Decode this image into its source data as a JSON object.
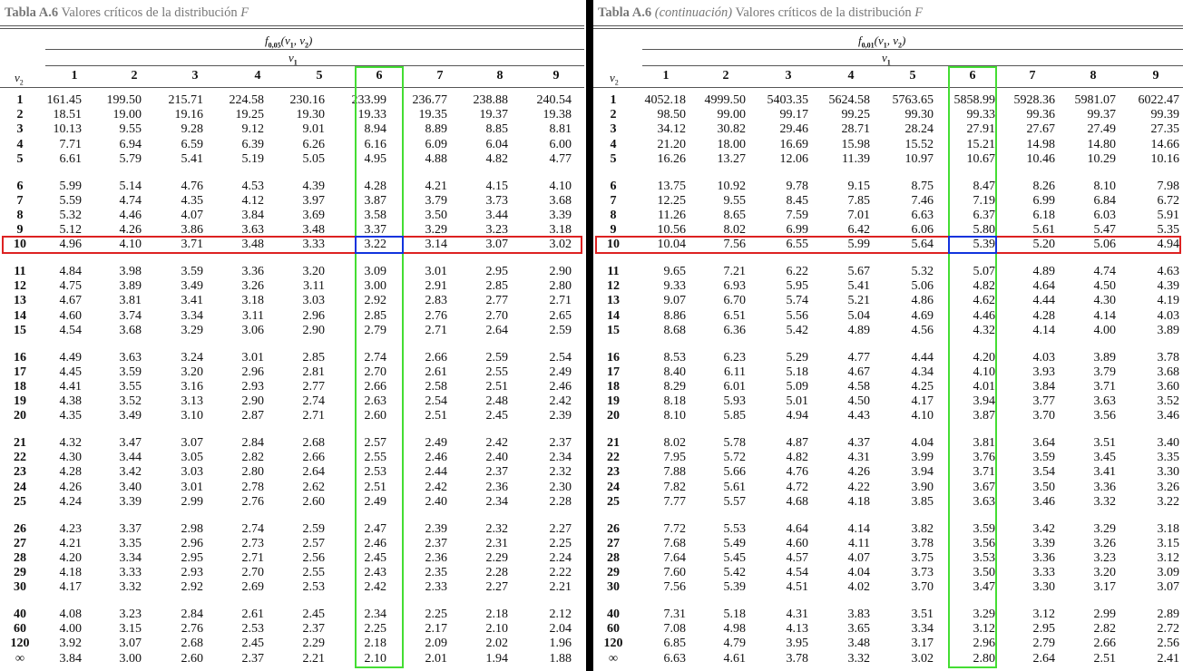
{
  "left": {
    "caption_prefix": "Tabla A.6",
    "caption_cont": "",
    "caption_text": "Valores críticos de la distribución",
    "caption_var": "F",
    "func_f": "f",
    "func_sub": "0,05",
    "func_args": "(v",
    "func_rest1": ", v",
    "func_rest2": ")",
    "v1_label": "v",
    "v2_label": "v",
    "columns": [
      "1",
      "2",
      "3",
      "4",
      "5",
      "6",
      "7",
      "8",
      "9"
    ],
    "rows": [
      {
        "v2": "1",
        "vals": [
          "161.45",
          "199.50",
          "215.71",
          "224.58",
          "230.16",
          "233.99",
          "236.77",
          "238.88",
          "240.54"
        ]
      },
      {
        "v2": "2",
        "vals": [
          "18.51",
          "19.00",
          "19.16",
          "19.25",
          "19.30",
          "19.33",
          "19.35",
          "19.37",
          "19.38"
        ]
      },
      {
        "v2": "3",
        "vals": [
          "10.13",
          "9.55",
          "9.28",
          "9.12",
          "9.01",
          "8.94",
          "8.89",
          "8.85",
          "8.81"
        ]
      },
      {
        "v2": "4",
        "vals": [
          "7.71",
          "6.94",
          "6.59",
          "6.39",
          "6.26",
          "6.16",
          "6.09",
          "6.04",
          "6.00"
        ]
      },
      {
        "v2": "5",
        "vals": [
          "6.61",
          "5.79",
          "5.41",
          "5.19",
          "5.05",
          "4.95",
          "4.88",
          "4.82",
          "4.77"
        ]
      },
      {
        "v2": "6",
        "vals": [
          "5.99",
          "5.14",
          "4.76",
          "4.53",
          "4.39",
          "4.28",
          "4.21",
          "4.15",
          "4.10"
        ]
      },
      {
        "v2": "7",
        "vals": [
          "5.59",
          "4.74",
          "4.35",
          "4.12",
          "3.97",
          "3.87",
          "3.79",
          "3.73",
          "3.68"
        ]
      },
      {
        "v2": "8",
        "vals": [
          "5.32",
          "4.46",
          "4.07",
          "3.84",
          "3.69",
          "3.58",
          "3.50",
          "3.44",
          "3.39"
        ]
      },
      {
        "v2": "9",
        "vals": [
          "5.12",
          "4.26",
          "3.86",
          "3.63",
          "3.48",
          "3.37",
          "3.29",
          "3.23",
          "3.18"
        ]
      },
      {
        "v2": "10",
        "vals": [
          "4.96",
          "4.10",
          "3.71",
          "3.48",
          "3.33",
          "3.22",
          "3.14",
          "3.07",
          "3.02"
        ]
      },
      {
        "v2": "11",
        "vals": [
          "4.84",
          "3.98",
          "3.59",
          "3.36",
          "3.20",
          "3.09",
          "3.01",
          "2.95",
          "2.90"
        ]
      },
      {
        "v2": "12",
        "vals": [
          "4.75",
          "3.89",
          "3.49",
          "3.26",
          "3.11",
          "3.00",
          "2.91",
          "2.85",
          "2.80"
        ]
      },
      {
        "v2": "13",
        "vals": [
          "4.67",
          "3.81",
          "3.41",
          "3.18",
          "3.03",
          "2.92",
          "2.83",
          "2.77",
          "2.71"
        ]
      },
      {
        "v2": "14",
        "vals": [
          "4.60",
          "3.74",
          "3.34",
          "3.11",
          "2.96",
          "2.85",
          "2.76",
          "2.70",
          "2.65"
        ]
      },
      {
        "v2": "15",
        "vals": [
          "4.54",
          "3.68",
          "3.29",
          "3.06",
          "2.90",
          "2.79",
          "2.71",
          "2.64",
          "2.59"
        ]
      },
      {
        "v2": "16",
        "vals": [
          "4.49",
          "3.63",
          "3.24",
          "3.01",
          "2.85",
          "2.74",
          "2.66",
          "2.59",
          "2.54"
        ]
      },
      {
        "v2": "17",
        "vals": [
          "4.45",
          "3.59",
          "3.20",
          "2.96",
          "2.81",
          "2.70",
          "2.61",
          "2.55",
          "2.49"
        ]
      },
      {
        "v2": "18",
        "vals": [
          "4.41",
          "3.55",
          "3.16",
          "2.93",
          "2.77",
          "2.66",
          "2.58",
          "2.51",
          "2.46"
        ]
      },
      {
        "v2": "19",
        "vals": [
          "4.38",
          "3.52",
          "3.13",
          "2.90",
          "2.74",
          "2.63",
          "2.54",
          "2.48",
          "2.42"
        ]
      },
      {
        "v2": "20",
        "vals": [
          "4.35",
          "3.49",
          "3.10",
          "2.87",
          "2.71",
          "2.60",
          "2.51",
          "2.45",
          "2.39"
        ]
      },
      {
        "v2": "21",
        "vals": [
          "4.32",
          "3.47",
          "3.07",
          "2.84",
          "2.68",
          "2.57",
          "2.49",
          "2.42",
          "2.37"
        ]
      },
      {
        "v2": "22",
        "vals": [
          "4.30",
          "3.44",
          "3.05",
          "2.82",
          "2.66",
          "2.55",
          "2.46",
          "2.40",
          "2.34"
        ]
      },
      {
        "v2": "23",
        "vals": [
          "4.28",
          "3.42",
          "3.03",
          "2.80",
          "2.64",
          "2.53",
          "2.44",
          "2.37",
          "2.32"
        ]
      },
      {
        "v2": "24",
        "vals": [
          "4.26",
          "3.40",
          "3.01",
          "2.78",
          "2.62",
          "2.51",
          "2.42",
          "2.36",
          "2.30"
        ]
      },
      {
        "v2": "25",
        "vals": [
          "4.24",
          "3.39",
          "2.99",
          "2.76",
          "2.60",
          "2.49",
          "2.40",
          "2.34",
          "2.28"
        ]
      },
      {
        "v2": "26",
        "vals": [
          "4.23",
          "3.37",
          "2.98",
          "2.74",
          "2.59",
          "2.47",
          "2.39",
          "2.32",
          "2.27"
        ]
      },
      {
        "v2": "27",
        "vals": [
          "4.21",
          "3.35",
          "2.96",
          "2.73",
          "2.57",
          "2.46",
          "2.37",
          "2.31",
          "2.25"
        ]
      },
      {
        "v2": "28",
        "vals": [
          "4.20",
          "3.34",
          "2.95",
          "2.71",
          "2.56",
          "2.45",
          "2.36",
          "2.29",
          "2.24"
        ]
      },
      {
        "v2": "29",
        "vals": [
          "4.18",
          "3.33",
          "2.93",
          "2.70",
          "2.55",
          "2.43",
          "2.35",
          "2.28",
          "2.22"
        ]
      },
      {
        "v2": "30",
        "vals": [
          "4.17",
          "3.32",
          "2.92",
          "2.69",
          "2.53",
          "2.42",
          "2.33",
          "2.27",
          "2.21"
        ]
      },
      {
        "v2": "40",
        "vals": [
          "4.08",
          "3.23",
          "2.84",
          "2.61",
          "2.45",
          "2.34",
          "2.25",
          "2.18",
          "2.12"
        ]
      },
      {
        "v2": "60",
        "vals": [
          "4.00",
          "3.15",
          "2.76",
          "2.53",
          "2.37",
          "2.25",
          "2.17",
          "2.10",
          "2.04"
        ]
      },
      {
        "v2": "120",
        "vals": [
          "3.92",
          "3.07",
          "2.68",
          "2.45",
          "2.29",
          "2.18",
          "2.09",
          "2.02",
          "1.96"
        ]
      },
      {
        "v2": "∞",
        "vals": [
          "3.84",
          "3.00",
          "2.60",
          "2.37",
          "2.21",
          "2.10",
          "2.01",
          "1.94",
          "1.88"
        ]
      }
    ]
  },
  "right": {
    "caption_prefix": "Tabla A.6",
    "caption_cont": "(continuación)",
    "caption_text": "Valores críticos de la distribución",
    "caption_var": "F",
    "func_f": "f",
    "func_sub": "0,01",
    "func_args": "(v",
    "func_rest1": ", v",
    "func_rest2": ")",
    "v1_label": "v",
    "v2_label": "v",
    "columns": [
      "1",
      "2",
      "3",
      "4",
      "5",
      "6",
      "7",
      "8",
      "9"
    ],
    "rows": [
      {
        "v2": "1",
        "vals": [
          "4052.18",
          "4999.50",
          "5403.35",
          "5624.58",
          "5763.65",
          "5858.99",
          "5928.36",
          "5981.07",
          "6022.47"
        ]
      },
      {
        "v2": "2",
        "vals": [
          "98.50",
          "99.00",
          "99.17",
          "99.25",
          "99.30",
          "99.33",
          "99.36",
          "99.37",
          "99.39"
        ]
      },
      {
        "v2": "3",
        "vals": [
          "34.12",
          "30.82",
          "29.46",
          "28.71",
          "28.24",
          "27.91",
          "27.67",
          "27.49",
          "27.35"
        ]
      },
      {
        "v2": "4",
        "vals": [
          "21.20",
          "18.00",
          "16.69",
          "15.98",
          "15.52",
          "15.21",
          "14.98",
          "14.80",
          "14.66"
        ]
      },
      {
        "v2": "5",
        "vals": [
          "16.26",
          "13.27",
          "12.06",
          "11.39",
          "10.97",
          "10.67",
          "10.46",
          "10.29",
          "10.16"
        ]
      },
      {
        "v2": "6",
        "vals": [
          "13.75",
          "10.92",
          "9.78",
          "9.15",
          "8.75",
          "8.47",
          "8.26",
          "8.10",
          "7.98"
        ]
      },
      {
        "v2": "7",
        "vals": [
          "12.25",
          "9.55",
          "8.45",
          "7.85",
          "7.46",
          "7.19",
          "6.99",
          "6.84",
          "6.72"
        ]
      },
      {
        "v2": "8",
        "vals": [
          "11.26",
          "8.65",
          "7.59",
          "7.01",
          "6.63",
          "6.37",
          "6.18",
          "6.03",
          "5.91"
        ]
      },
      {
        "v2": "9",
        "vals": [
          "10.56",
          "8.02",
          "6.99",
          "6.42",
          "6.06",
          "5.80",
          "5.61",
          "5.47",
          "5.35"
        ]
      },
      {
        "v2": "10",
        "vals": [
          "10.04",
          "7.56",
          "6.55",
          "5.99",
          "5.64",
          "5.39",
          "5.20",
          "5.06",
          "4.94"
        ]
      },
      {
        "v2": "11",
        "vals": [
          "9.65",
          "7.21",
          "6.22",
          "5.67",
          "5.32",
          "5.07",
          "4.89",
          "4.74",
          "4.63"
        ]
      },
      {
        "v2": "12",
        "vals": [
          "9.33",
          "6.93",
          "5.95",
          "5.41",
          "5.06",
          "4.82",
          "4.64",
          "4.50",
          "4.39"
        ]
      },
      {
        "v2": "13",
        "vals": [
          "9.07",
          "6.70",
          "5.74",
          "5.21",
          "4.86",
          "4.62",
          "4.44",
          "4.30",
          "4.19"
        ]
      },
      {
        "v2": "14",
        "vals": [
          "8.86",
          "6.51",
          "5.56",
          "5.04",
          "4.69",
          "4.46",
          "4.28",
          "4.14",
          "4.03"
        ]
      },
      {
        "v2": "15",
        "vals": [
          "8.68",
          "6.36",
          "5.42",
          "4.89",
          "4.56",
          "4.32",
          "4.14",
          "4.00",
          "3.89"
        ]
      },
      {
        "v2": "16",
        "vals": [
          "8.53",
          "6.23",
          "5.29",
          "4.77",
          "4.44",
          "4.20",
          "4.03",
          "3.89",
          "3.78"
        ]
      },
      {
        "v2": "17",
        "vals": [
          "8.40",
          "6.11",
          "5.18",
          "4.67",
          "4.34",
          "4.10",
          "3.93",
          "3.79",
          "3.68"
        ]
      },
      {
        "v2": "18",
        "vals": [
          "8.29",
          "6.01",
          "5.09",
          "4.58",
          "4.25",
          "4.01",
          "3.84",
          "3.71",
          "3.60"
        ]
      },
      {
        "v2": "19",
        "vals": [
          "8.18",
          "5.93",
          "5.01",
          "4.50",
          "4.17",
          "3.94",
          "3.77",
          "3.63",
          "3.52"
        ]
      },
      {
        "v2": "20",
        "vals": [
          "8.10",
          "5.85",
          "4.94",
          "4.43",
          "4.10",
          "3.87",
          "3.70",
          "3.56",
          "3.46"
        ]
      },
      {
        "v2": "21",
        "vals": [
          "8.02",
          "5.78",
          "4.87",
          "4.37",
          "4.04",
          "3.81",
          "3.64",
          "3.51",
          "3.40"
        ]
      },
      {
        "v2": "22",
        "vals": [
          "7.95",
          "5.72",
          "4.82",
          "4.31",
          "3.99",
          "3.76",
          "3.59",
          "3.45",
          "3.35"
        ]
      },
      {
        "v2": "23",
        "vals": [
          "7.88",
          "5.66",
          "4.76",
          "4.26",
          "3.94",
          "3.71",
          "3.54",
          "3.41",
          "3.30"
        ]
      },
      {
        "v2": "24",
        "vals": [
          "7.82",
          "5.61",
          "4.72",
          "4.22",
          "3.90",
          "3.67",
          "3.50",
          "3.36",
          "3.26"
        ]
      },
      {
        "v2": "25",
        "vals": [
          "7.77",
          "5.57",
          "4.68",
          "4.18",
          "3.85",
          "3.63",
          "3.46",
          "3.32",
          "3.22"
        ]
      },
      {
        "v2": "26",
        "vals": [
          "7.72",
          "5.53",
          "4.64",
          "4.14",
          "3.82",
          "3.59",
          "3.42",
          "3.29",
          "3.18"
        ]
      },
      {
        "v2": "27",
        "vals": [
          "7.68",
          "5.49",
          "4.60",
          "4.11",
          "3.78",
          "3.56",
          "3.39",
          "3.26",
          "3.15"
        ]
      },
      {
        "v2": "28",
        "vals": [
          "7.64",
          "5.45",
          "4.57",
          "4.07",
          "3.75",
          "3.53",
          "3.36",
          "3.23",
          "3.12"
        ]
      },
      {
        "v2": "29",
        "vals": [
          "7.60",
          "5.42",
          "4.54",
          "4.04",
          "3.73",
          "3.50",
          "3.33",
          "3.20",
          "3.09"
        ]
      },
      {
        "v2": "30",
        "vals": [
          "7.56",
          "5.39",
          "4.51",
          "4.02",
          "3.70",
          "3.47",
          "3.30",
          "3.17",
          "3.07"
        ]
      },
      {
        "v2": "40",
        "vals": [
          "7.31",
          "5.18",
          "4.31",
          "3.83",
          "3.51",
          "3.29",
          "3.12",
          "2.99",
          "2.89"
        ]
      },
      {
        "v2": "60",
        "vals": [
          "7.08",
          "4.98",
          "4.13",
          "3.65",
          "3.34",
          "3.12",
          "2.95",
          "2.82",
          "2.72"
        ]
      },
      {
        "v2": "120",
        "vals": [
          "6.85",
          "4.79",
          "3.95",
          "3.48",
          "3.17",
          "2.96",
          "2.79",
          "2.66",
          "2.56"
        ]
      },
      {
        "v2": "∞",
        "vals": [
          "6.63",
          "4.61",
          "3.78",
          "3.32",
          "3.02",
          "2.80",
          "2.64",
          "2.51",
          "2.41"
        ]
      }
    ]
  },
  "highlights": {
    "column": "6",
    "row": "10",
    "column_color": "#44dd33",
    "row_color": "#dd2222",
    "cell_color": "#1133dd"
  }
}
